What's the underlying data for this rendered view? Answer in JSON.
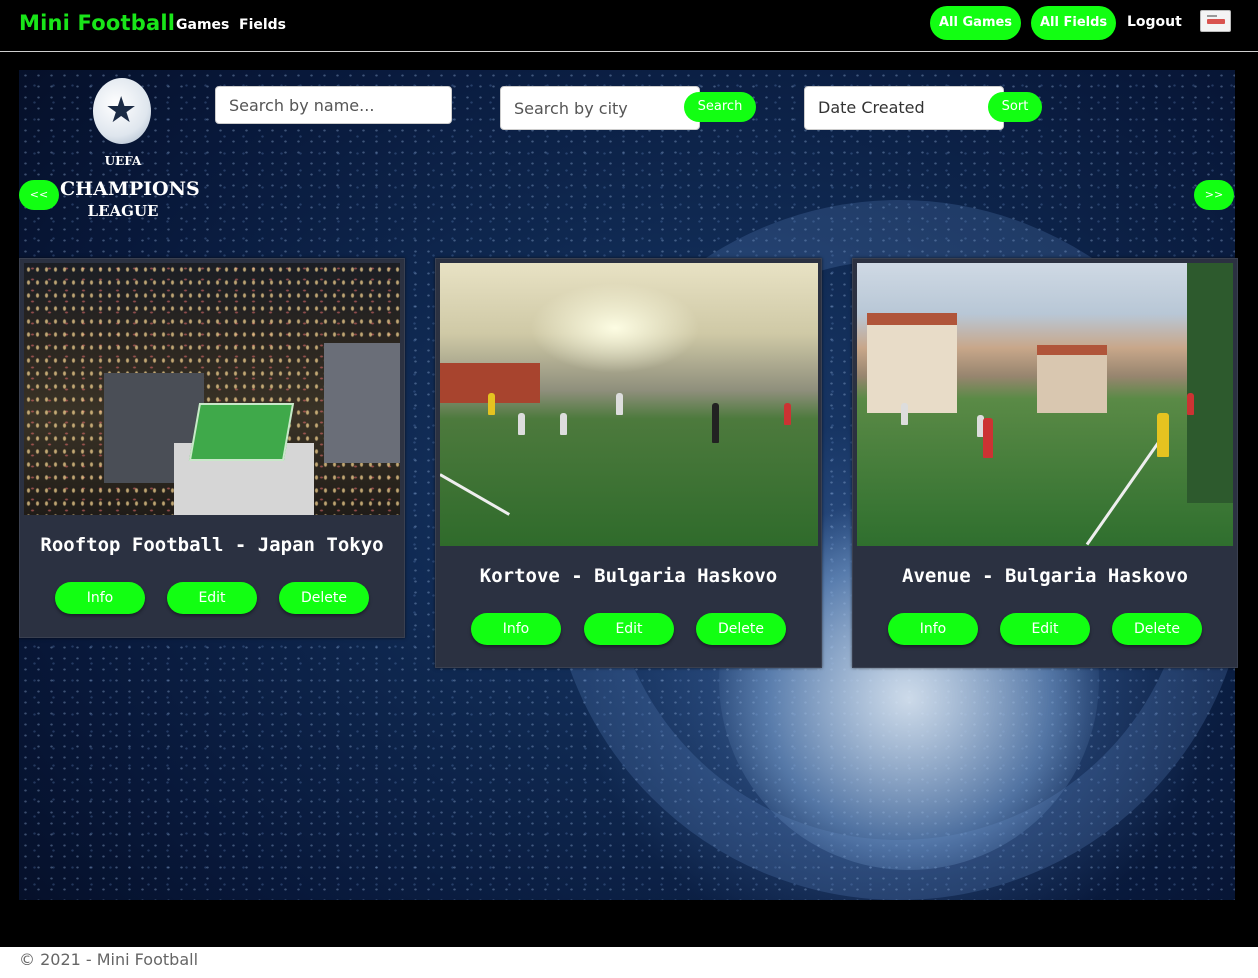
{
  "nav": {
    "brand": "Mini Football",
    "links": [
      "Games",
      "Fields"
    ],
    "all_games": "All Games",
    "all_fields": "All Fields",
    "logout": "Logout"
  },
  "controls": {
    "name_placeholder": "Search by name...",
    "city_placeholder": "Search by city",
    "search_label": "Search",
    "sort_value": "Date Created",
    "sort_label": "Sort",
    "prev_label": "<<",
    "next_label": ">>"
  },
  "logo": {
    "line1": "UEFA",
    "line2": "CHAMPIONS",
    "line3": "LEAGUE"
  },
  "fields": [
    {
      "title": "Rooftop Football - Japan Tokyo",
      "info": "Info",
      "edit": "Edit",
      "delete": "Delete"
    },
    {
      "title": "Kortove - Bulgaria Haskovo",
      "info": "Info",
      "edit": "Edit",
      "delete": "Delete"
    },
    {
      "title": "Avenue - Bulgaria Haskovo",
      "info": "Info",
      "edit": "Edit",
      "delete": "Delete"
    }
  ],
  "footer": {
    "text": "© 2021 - Mini Football"
  },
  "colors": {
    "accent": "#12ff12",
    "brand": "#19e619",
    "card_bg": "#2b3141"
  }
}
